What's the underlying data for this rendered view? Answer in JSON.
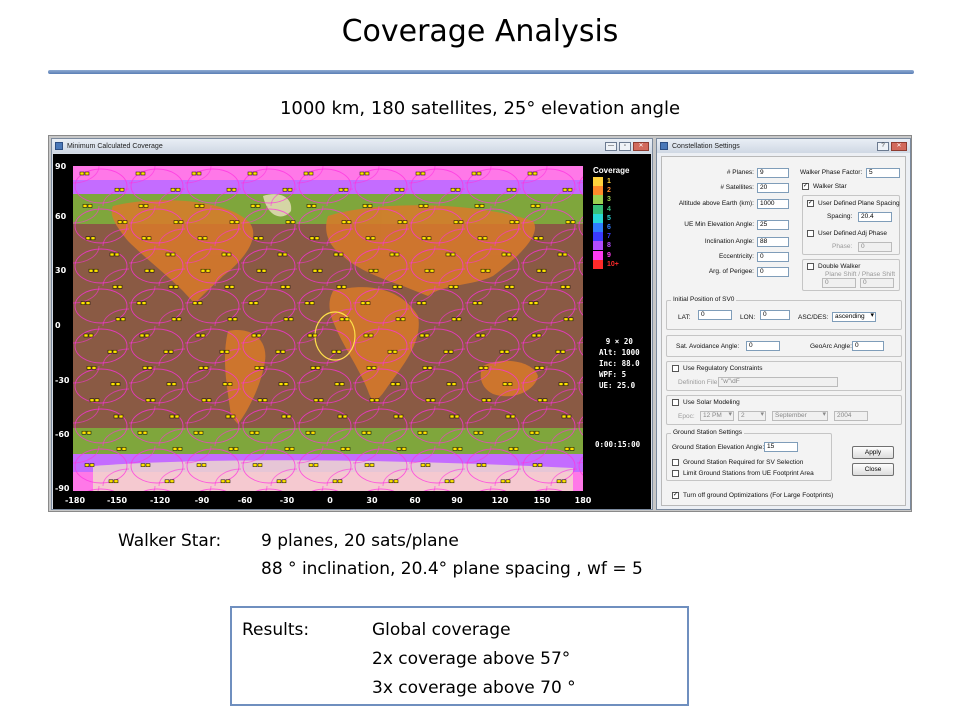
{
  "slide": {
    "title": "Coverage Analysis",
    "subtitle": "1000 km, 180 satellites, 25° elevation angle"
  },
  "map_window": {
    "title": "Minimum Calculated Coverage",
    "y_labels": [
      "90",
      "60",
      "30",
      "0",
      "-30",
      "-60",
      "-90"
    ],
    "x_labels": [
      "-180",
      "-150",
      "-120",
      "-90",
      "-60",
      "-30",
      "0",
      "30",
      "60",
      "90",
      "120",
      "150",
      "180"
    ],
    "legend_title": "Coverage",
    "legend": [
      {
        "label": "1",
        "color": "#ffd23c"
      },
      {
        "label": "2",
        "color": "#ff8a2a"
      },
      {
        "label": "3",
        "color": "#9bd050"
      },
      {
        "label": "4",
        "color": "#38c07a"
      },
      {
        "label": "5",
        "color": "#28d8d8"
      },
      {
        "label": "6",
        "color": "#2f7cff"
      },
      {
        "label": "7",
        "color": "#3a3aff"
      },
      {
        "label": "8",
        "color": "#b24cff"
      },
      {
        "label": "9",
        "color": "#ff3cf0"
      },
      {
        "label": "10+",
        "color": "#ff2a2a"
      }
    ],
    "params": [
      "9 × 20",
      "Alt: 1000",
      "Inc: 88.0",
      "WPF: 5",
      "UE: 25.0"
    ],
    "sim_time": "0:00:15:00"
  },
  "settings_window": {
    "title": "Constellation Settings",
    "help": "?",
    "planes_label": "# Planes:",
    "planes_value": "9",
    "sats_label": "# Satellites:",
    "sats_value": "20",
    "alt_label": "Altitude above Earth (km):",
    "alt_value": "1000",
    "elev_label": "UE Min Elevation Angle:",
    "elev_value": "25",
    "inc_label": "Inclination Angle:",
    "inc_value": "88",
    "ecc_label": "Eccentricity:",
    "ecc_value": "0",
    "peri_label": "Arg. of Perigee:",
    "peri_value": "0",
    "wpf_label": "Walker Phase Factor:",
    "wpf_value": "5",
    "walker_star_label": "Walker Star",
    "udps_label": "User Defined Plane Spacing",
    "spacing_label": "Spacing:",
    "spacing_value": "20.4",
    "udap_label": "User Defined Adj Phase",
    "phase_label": "Phase:",
    "phase_value": "0",
    "double_walker_label": "Double Walker",
    "plane_shift_label": "Plane Shift / Phase Shift",
    "plane_shift_value": "0",
    "phase_shift_value": "0",
    "sv0_group": "Initial Position of SV0",
    "lat_label": "LAT:",
    "lat_value": "0",
    "lon_label": "LON:",
    "lon_value": "0",
    "ascdes_label": "ASC/DES:",
    "ascdes_value": "ascending",
    "sat_avoid_label": "Sat. Avoidance Angle:",
    "sat_avoid_value": "0",
    "geoarc_label": "GeoArc Angle:",
    "geoarc_value": "0",
    "reg_label": "Use Regulatory Constraints",
    "def_file_label": "Definition File:",
    "def_file_value": "\"w\"\\dF",
    "solar_label": "Use Solar Modeling",
    "epoc_label": "Epoc:",
    "epoc_hour": "12 PM",
    "epoc_day": "2",
    "epoc_month": "September",
    "epoc_year": "2004",
    "gs_group": "Ground Station Settings",
    "gs_elev_label": "Ground Station Elevation Angle:",
    "gs_elev_value": "15",
    "gs_req_label": "Ground Station Required for SV Selection",
    "gs_limit_label": "Limit Ground Stations from UE Footprint Area",
    "apply_label": "Apply",
    "close_label": "Close",
    "optim_label": "Turn off ground Optimizations (For Large Footprints)"
  },
  "walker": {
    "label": "Walker Star:",
    "line1": "9 planes, 20 sats/plane",
    "line2": "88 ° inclination, 20.4° plane spacing ,  wf = 5"
  },
  "results": {
    "label": "Results:",
    "line1": "Global coverage",
    "line2": "2x coverage above 57°",
    "line3": "3x coverage above 70 °"
  }
}
